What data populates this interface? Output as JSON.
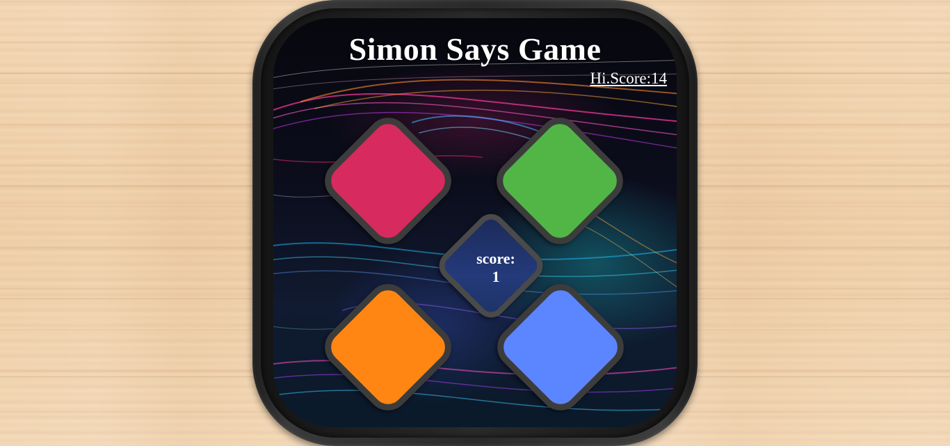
{
  "game": {
    "title": "Simon Says Game",
    "hiscore_label": "Hi.Score:14",
    "score_label": "score:",
    "score_value": "1"
  },
  "pads": [
    {
      "name": "red-pad",
      "color": "#d72a5e"
    },
    {
      "name": "green-pad",
      "color": "#52b646"
    },
    {
      "name": "orange-pad",
      "color": "#ff8613"
    },
    {
      "name": "blue-pad",
      "color": "#5b86ff"
    }
  ],
  "colors": {
    "table": "#f1d3b0",
    "device_frame": "#2a2a2a",
    "center_box": "#243a7a",
    "text": "#ffffff"
  }
}
